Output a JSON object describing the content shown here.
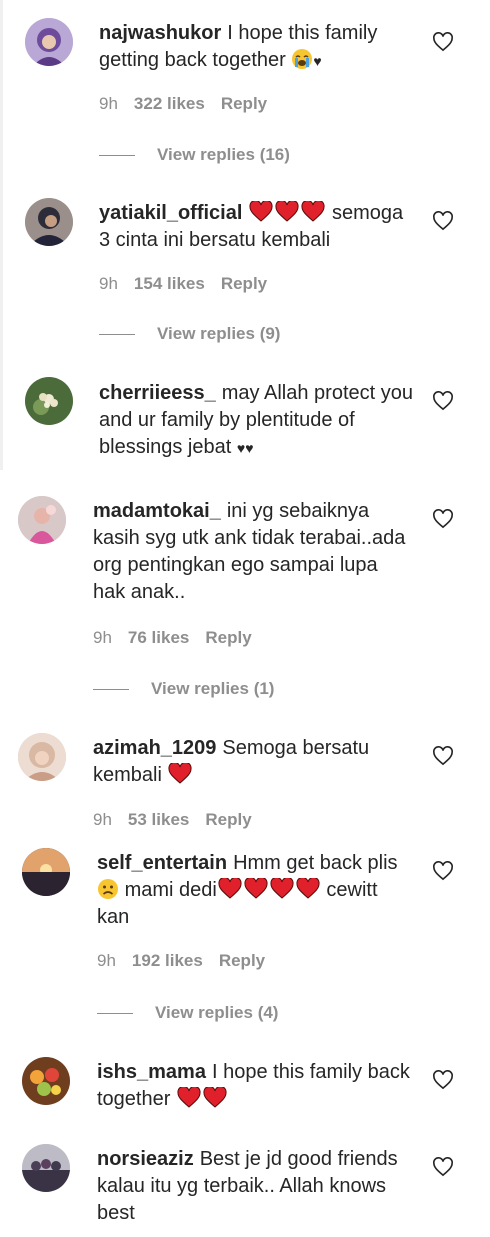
{
  "comments": [
    {
      "username": "najwashukor",
      "text_before": "I hope this family getting back together",
      "text_after": "",
      "meta": {
        "time": "9h",
        "likes": "322 likes",
        "reply": "Reply"
      },
      "view_replies": "View replies (16)",
      "avatar_icon": "avatar-hijab-purple"
    },
    {
      "username": "yatiakil_official",
      "text_before": "",
      "text_after": "semoga 3 cinta ini bersatu kembali",
      "meta": {
        "time": "9h",
        "likes": "154 likes",
        "reply": "Reply"
      },
      "view_replies": "View replies (9)",
      "avatar_icon": "avatar-woman-dark"
    },
    {
      "username": "cherriieess_",
      "text_before": "may Allah protect you and ur family by plentitude of blessings jebat",
      "text_after": "",
      "avatar_icon": "avatar-flower-green"
    },
    {
      "username": "madamtokai_",
      "text_before": "ini yg sebaiknya kasih syg utk ank tidak terabai..ada org pentingkan ego sampai lupa hak anak..",
      "text_after": "",
      "meta": {
        "time": "9h",
        "likes": "76 likes",
        "reply": "Reply"
      },
      "view_replies": "View replies (1)",
      "avatar_icon": "avatar-pink-child"
    },
    {
      "username": "azimah_1209",
      "text_before": "Semoga bersatu kembali",
      "text_after": "",
      "meta": {
        "time": "9h",
        "likes": "53 likes",
        "reply": "Reply"
      },
      "avatar_icon": "avatar-hijab-light"
    },
    {
      "username": "self_entertain",
      "text_before": "Hmm get back plis",
      "text_middle": "mami dedi",
      "text_after": "cewitt kan",
      "meta": {
        "time": "9h",
        "likes": "192 likes",
        "reply": "Reply"
      },
      "view_replies": "View replies (4)",
      "avatar_icon": "avatar-sunset"
    },
    {
      "username": "ishs_mama",
      "text_before": "I hope this family back together",
      "text_after": "",
      "avatar_icon": "avatar-fruits"
    },
    {
      "username": "norsieaziz",
      "text_before": "Best je jd good friends kalau itu yg terbaik.. Allah knows best",
      "text_after": "",
      "avatar_icon": "avatar-group-dark"
    }
  ],
  "colors": {
    "text": "#262626",
    "secondary": "#8e8e8e",
    "heart_red": "#e0202b"
  },
  "icons": {
    "like": "heart-outline-icon",
    "heart": "red-heart-emoji",
    "crying": "crying-face-emoji",
    "sad": "sad-face-emoji"
  }
}
